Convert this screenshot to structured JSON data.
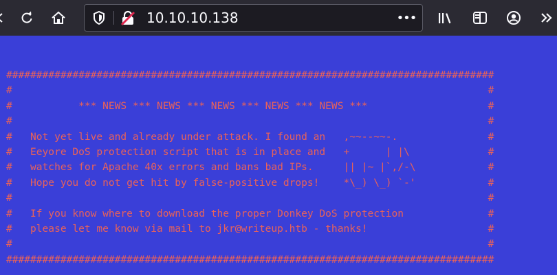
{
  "browser": {
    "url": "10.10.10.138",
    "more_label": "•••",
    "icons": [
      "reload-icon",
      "home-icon",
      "shield-icon",
      "insecure-lock-icon",
      "library-icon",
      "sidebar-icon",
      "account-icon",
      "overflow-chevron-icon"
    ],
    "colors": {
      "toolbar": "#2b2a33",
      "urlbar": "#1c1b22",
      "text": "#fbfbfe"
    }
  },
  "page": {
    "background": "#3a3fd8",
    "text_color": "#e8625a",
    "lines": [
      "#################################################################################",
      "#                                                                               #",
      "#           *** NEWS *** NEWS *** NEWS *** NEWS *** NEWS ***                    #",
      "#                                                                               #",
      "#   Not yet live and already under attack. I found an   ,~~--~~-.               #",
      "#   Eeyore DoS protection script that is in place and   +      | |\\             #",
      "#   watches for Apache 40x errors and bans bad IPs.     || |~ |`,/-\\            #",
      "#   Hope you do not get hit by false-positive drops!    *\\_) \\_) `-'            #",
      "#                                                                               #",
      "#   If you know where to download the proper Donkey DoS protection              #",
      "#   please let me know via mail to jkr@writeup.htb - thanks!                    #",
      "#                                                                               #",
      "#################################################################################"
    ]
  }
}
